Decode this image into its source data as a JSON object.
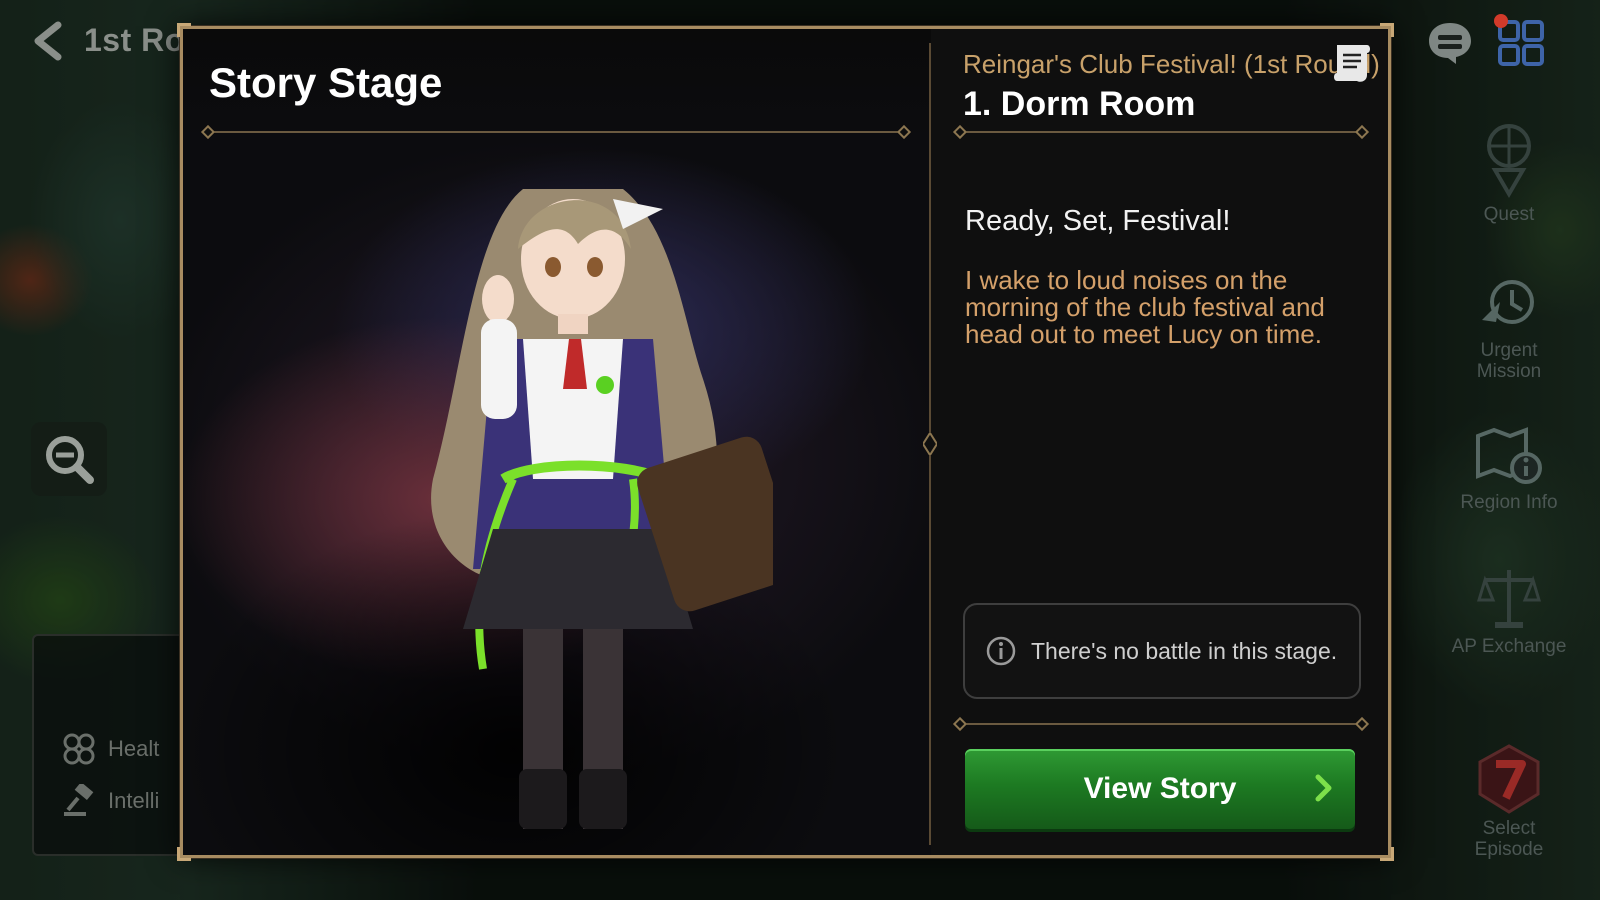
{
  "background": {
    "back_title": "1st Ro",
    "stats": [
      {
        "label": "Healt",
        "icon": "clover-icon"
      },
      {
        "label": "Intelli",
        "icon": "gavel-icon"
      }
    ]
  },
  "sidebar": {
    "items": [
      {
        "label": "Quest",
        "icon": "quest-icon"
      },
      {
        "label": "Urgent Mission",
        "icon": "urgent-mission-icon"
      },
      {
        "label": "Region Info",
        "icon": "region-info-icon"
      },
      {
        "label": "AP Exchange",
        "icon": "scales-icon"
      },
      {
        "label": "Select Episode",
        "icon": "episode-seven-icon"
      }
    ]
  },
  "modal": {
    "title": "Story Stage",
    "event_name": "Reingar's Club Festival! (1st Round)",
    "stage_name": "1. Dorm Room",
    "story_heading": "Ready, Set, Festival!",
    "story_description": "I wake to loud noises on the morning of the club festival and head out to meet Lucy on time.",
    "notice": "There's no battle in this stage.",
    "button_label": "View Story"
  },
  "colors": {
    "frame": "#a88c61",
    "accent_gold": "#c8a16a",
    "button_green": "#1d7a22",
    "arrow_green": "#7de04a"
  }
}
